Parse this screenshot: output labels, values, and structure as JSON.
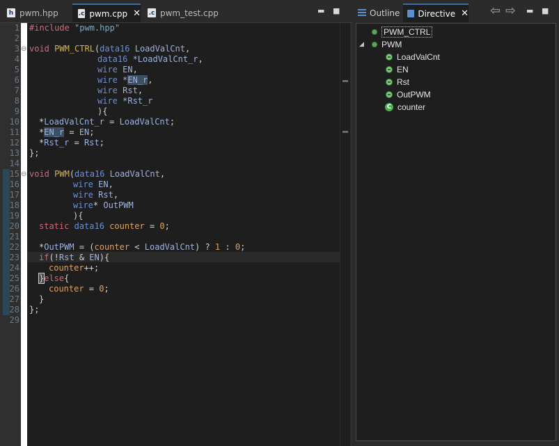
{
  "editor": {
    "tabs": [
      {
        "label": "pwm.hpp",
        "icon": "h-file-icon",
        "icon_letter": "h"
      },
      {
        "label": "pwm.cpp",
        "icon": "c-file-icon",
        "icon_letter": ".c",
        "close": "✕"
      },
      {
        "label": "pwm_test.cpp",
        "icon": "c-file-icon",
        "icon_letter": ".c"
      }
    ],
    "window_controls": {
      "minimize": "▬",
      "maximize": "■"
    },
    "line_numbers": [
      "1",
      "2",
      "3",
      "4",
      "5",
      "6",
      "7",
      "8",
      "9",
      "10",
      "11",
      "12",
      "13",
      "14",
      "15",
      "16",
      "17",
      "18",
      "19",
      "20",
      "21",
      "22",
      "23",
      "24",
      "25",
      "26",
      "27",
      "28",
      "29"
    ],
    "fold_markers": {
      "line3": "⊖",
      "line15": "⊖"
    }
  },
  "code": {
    "l1": {
      "a": "#include ",
      "b": "\"pwm.hpp\""
    },
    "l3": {
      "a": "void ",
      "b": "PWM_CTRL",
      "c": "(",
      "d": "data16 ",
      "e": "LoadValCnt",
      "f": ","
    },
    "l4": {
      "a": "data16 ",
      "b": "*LoadValCnt_r",
      "c": ","
    },
    "l5": {
      "a": "wire ",
      "b": "EN",
      "c": ","
    },
    "l6": {
      "a": "wire ",
      "b": "*",
      "c": "EN_r",
      "d": ","
    },
    "l7": {
      "a": "wire ",
      "b": "Rst",
      "c": ","
    },
    "l8": {
      "a": "wire ",
      "b": "*Rst_r"
    },
    "l9": {
      "a": "){"
    },
    "l10": {
      "a": "*",
      "b": "LoadValCnt_r",
      "c": " = ",
      "d": "LoadValCnt",
      "e": ";"
    },
    "l11": {
      "a": "*",
      "b": "EN_r",
      "c": " = ",
      "d": "EN",
      "e": ";"
    },
    "l12": {
      "a": "*",
      "b": "Rst_r",
      "c": " = ",
      "d": "Rst",
      "e": ";"
    },
    "l13": {
      "a": "};"
    },
    "l15": {
      "a": "void ",
      "b": "PWM",
      "c": "(",
      "d": "data16 ",
      "e": "LoadValCnt",
      "f": ","
    },
    "l16": {
      "a": "wire ",
      "b": "EN",
      "c": ","
    },
    "l17": {
      "a": "wire ",
      "b": "Rst",
      "c": ","
    },
    "l18": {
      "a": "wire",
      "b": "* ",
      "c": "OutPWM"
    },
    "l19": {
      "a": "){"
    },
    "l20": {
      "a": "static ",
      "b": "data16 ",
      "c": "counter",
      "d": " = ",
      "e": "0",
      "f": ";"
    },
    "l22": {
      "a": "*",
      "b": "OutPWM",
      "c": " = (",
      "d": "counter",
      "e": " < ",
      "f": "LoadValCnt",
      "g": ") ? ",
      "h": "1",
      "i": " : ",
      "j": "0",
      "k": ";"
    },
    "l23": {
      "a": "if",
      "b": "(!",
      "c": "Rst",
      "d": " & ",
      "e": "EN",
      "f": "){"
    },
    "l24": {
      "a": "counter",
      "b": "++;"
    },
    "l25": {
      "a": "}",
      "b": "else",
      "c": "{"
    },
    "l26": {
      "a": "counter",
      "b": " = ",
      "c": "0",
      "d": ";"
    },
    "l27": {
      "a": "}"
    },
    "l28": {
      "a": "};"
    }
  },
  "side": {
    "tabs": [
      {
        "label": "Outline",
        "icon": "outline-icon"
      },
      {
        "label": "Directive",
        "icon": "directive-icon",
        "close": "✕"
      }
    ],
    "nav": {
      "back": "⇦",
      "forward": "⇨",
      "minimize": "▬",
      "maximize": "■"
    },
    "tree": [
      {
        "label": "PWM_CTRL",
        "icon": "function-dot-icon",
        "level": 0,
        "selected": true
      },
      {
        "label": "PWM",
        "icon": "function-dot-icon",
        "level": 0,
        "expanded": true,
        "toggle": "◢"
      },
      {
        "label": "LoadValCnt",
        "icon": "port-icon",
        "level": 1
      },
      {
        "label": "EN",
        "icon": "port-icon",
        "level": 1
      },
      {
        "label": "Rst",
        "icon": "port-icon",
        "level": 1
      },
      {
        "label": "OutPWM",
        "icon": "port-icon",
        "level": 1
      },
      {
        "label": "counter",
        "icon": "c-variable-icon",
        "icon_letter": "C",
        "level": 1
      }
    ]
  },
  "colors": {
    "keyword": "#cc6a7a",
    "type": "#6e8fd6",
    "function": "#d5b24a",
    "string": "#79a8c8",
    "number": "#e0a060",
    "identifier": "#9eb3e0",
    "tab_accent": "#3a6ea5",
    "tree_icon": "#5aa85a"
  }
}
